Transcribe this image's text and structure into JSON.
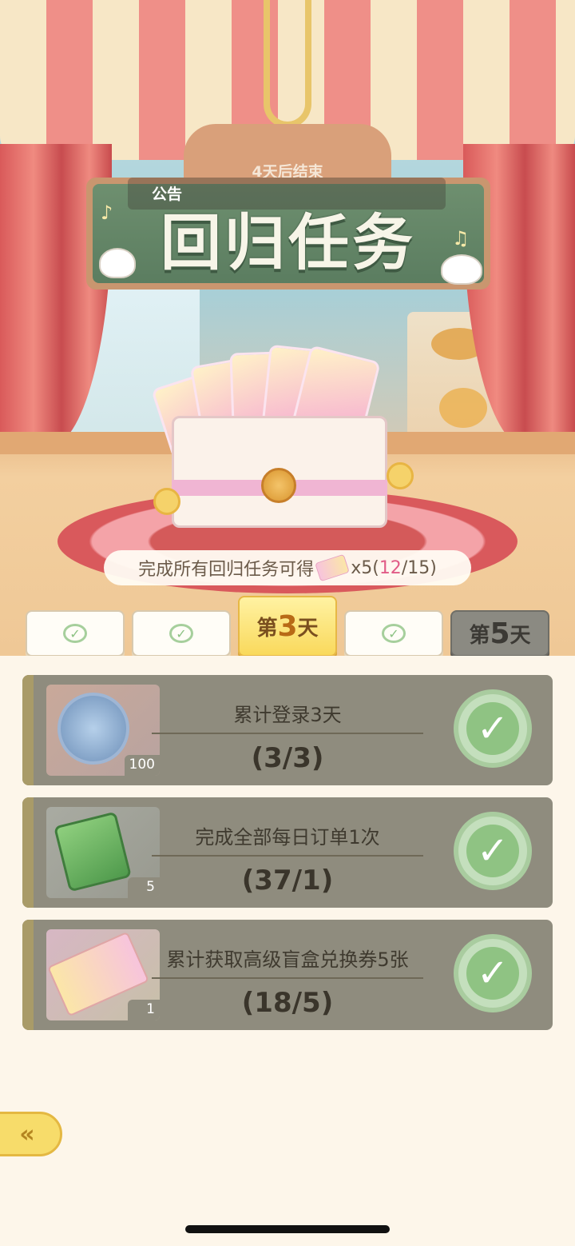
{
  "header": {
    "ends_in": "4天后结束",
    "notice_label": "公告",
    "title": "回归任务"
  },
  "reward": {
    "prefix": "完成所有回归任务可得",
    "multiplier": "x5",
    "open_paren": "(",
    "current": "12",
    "total": "/15)"
  },
  "days": {
    "day3_prefix": "第",
    "day3_num": "3",
    "day3_suffix": "天",
    "day5_prefix": "第",
    "day5_num": "5",
    "day5_suffix": "天",
    "check_symbol": "✓"
  },
  "tasks": [
    {
      "title": "累计登录3天",
      "progress": "(3/3)",
      "quantity": "100",
      "icon": "compass-coin-icon"
    },
    {
      "title": "完成全部每日订单1次",
      "progress": "(37/1)",
      "quantity": "5",
      "icon": "time-ticket-30min-icon"
    },
    {
      "title": "累计获取高级盲盒兑换券5张",
      "progress": "(18/5)",
      "quantity": "1",
      "icon": "blindbox-voucher-icon"
    }
  ],
  "done_symbol": "✓",
  "back_symbol": "«",
  "colors": {
    "accent_gold": "#f9d95c",
    "task_bg": "#8f8c7e",
    "done_green": "#8fc383",
    "highlight_pink": "#e15c87"
  }
}
